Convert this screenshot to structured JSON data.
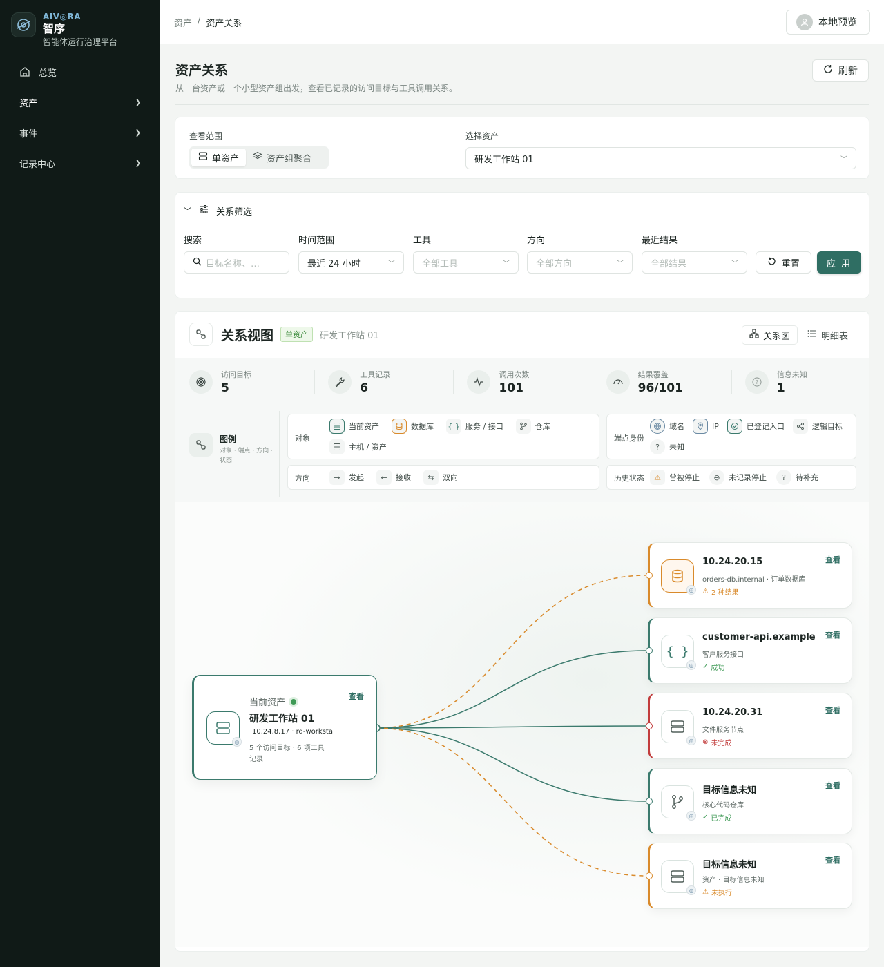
{
  "brand": {
    "tag": "AIV◎RA",
    "name": "智序",
    "subtitle": "智能体运行治理平台"
  },
  "nav": [
    {
      "label": "总览",
      "icon": "home-icon"
    },
    {
      "label": "资产",
      "icon": "chevron-down-icon"
    },
    {
      "label": "事件",
      "icon": "chevron-down-icon"
    },
    {
      "label": "记录中心",
      "icon": "chevron-down-icon"
    }
  ],
  "breadcrumb": {
    "root": "资产",
    "sep": "/",
    "current": "资产关系"
  },
  "topbar": {
    "preview_label": "本地预览"
  },
  "page": {
    "title": "资产关系",
    "description": "从一台资产或一个小型资产组出发，查看已记录的访问目标与工具调用关系。",
    "refresh_label": "刷新"
  },
  "scope": {
    "label": "查看范围",
    "options": [
      "单资产",
      "资产组聚合"
    ],
    "selected": "单资产",
    "asset_label": "选择资产",
    "asset_value": "研发工作站 01"
  },
  "filters": {
    "title": "关系筛选",
    "search_label": "搜索",
    "search_placeholder": "目标名称、…",
    "time_label": "时间范围",
    "time_value": "最近 24 小时",
    "tool_label": "工具",
    "tool_value": "全部工具",
    "direction_label": "方向",
    "direction_value": "全部方向",
    "result_label": "最近结果",
    "result_value": "全部结果",
    "reset_label": "重置",
    "apply_label": "应 用"
  },
  "relation": {
    "title": "关系视图",
    "badge": "单资产",
    "subject": "研发工作站 01",
    "views": [
      "关系图",
      "明细表"
    ],
    "stats": [
      {
        "label": "访问目标",
        "value": "5",
        "icon": "target-icon"
      },
      {
        "label": "工具记录",
        "value": "6",
        "icon": "wrench-icon"
      },
      {
        "label": "调用次数",
        "value": "101",
        "icon": "pulse-icon"
      },
      {
        "label": "结果覆盖",
        "value": "96/101",
        "icon": "gauge-icon"
      },
      {
        "label": "信息未知",
        "value": "1",
        "icon": "question-icon"
      }
    ],
    "legend": {
      "title": "图例",
      "subtitle": "对象 · 端点 · 方向 · 状态",
      "object_label": "对象",
      "objects": [
        "当前资产",
        "数据库",
        "服务 / 接口",
        "仓库",
        "主机 / 资产"
      ],
      "endpoint_label": "端点身份",
      "endpoints": [
        "域名",
        "IP",
        "已登记入口",
        "逻辑目标",
        "未知"
      ],
      "direction_label": "方向",
      "directions": [
        "发起",
        "接收",
        "双向"
      ],
      "history_label": "历史状态",
      "history": [
        "曾被停止",
        "未记录停止",
        "待补充"
      ]
    },
    "source": {
      "kind": "当前资产",
      "name": "研发工作站 01",
      "ip": "10.24.8.17 · rd-worksta",
      "summary_line1": "5 个访问目标 · 6 项工具",
      "summary_line2": "记录",
      "look": "查看"
    },
    "targets": [
      {
        "title": "10.24.20.15",
        "sub": "orders-db.internal · 订单数据库",
        "status": "2 种结果",
        "status_color": "#d98a2b",
        "accent": "#d98a2b",
        "icon": "database-icon",
        "look": "查看"
      },
      {
        "title": "customer-api.example",
        "sub": "客户服务接口",
        "status": "成功",
        "status_color": "#3f9a56",
        "accent": "#3b7a6d",
        "icon": "braces-icon",
        "look": "查看"
      },
      {
        "title": "10.24.20.31",
        "sub": "文件服务节点",
        "status": "未完成",
        "status_color": "#c23c3c",
        "accent": "#c23c3c",
        "icon": "server-icon",
        "look": "查看"
      },
      {
        "title": "目标信息未知",
        "sub": "核心代码仓库",
        "status": "已完成",
        "status_color": "#3f9a56",
        "accent": "#3b7a6d",
        "icon": "branch-icon",
        "look": "查看"
      },
      {
        "title": "目标信息未知",
        "sub": "资产 · 目标信息未知",
        "status": "未执行",
        "status_color": "#d98a2b",
        "accent": "#d98a2b",
        "icon": "server-icon",
        "look": "查看"
      }
    ],
    "colors": {
      "solid_edge": "#3b7a6d",
      "dashed_edge": "#d98a2b"
    }
  }
}
